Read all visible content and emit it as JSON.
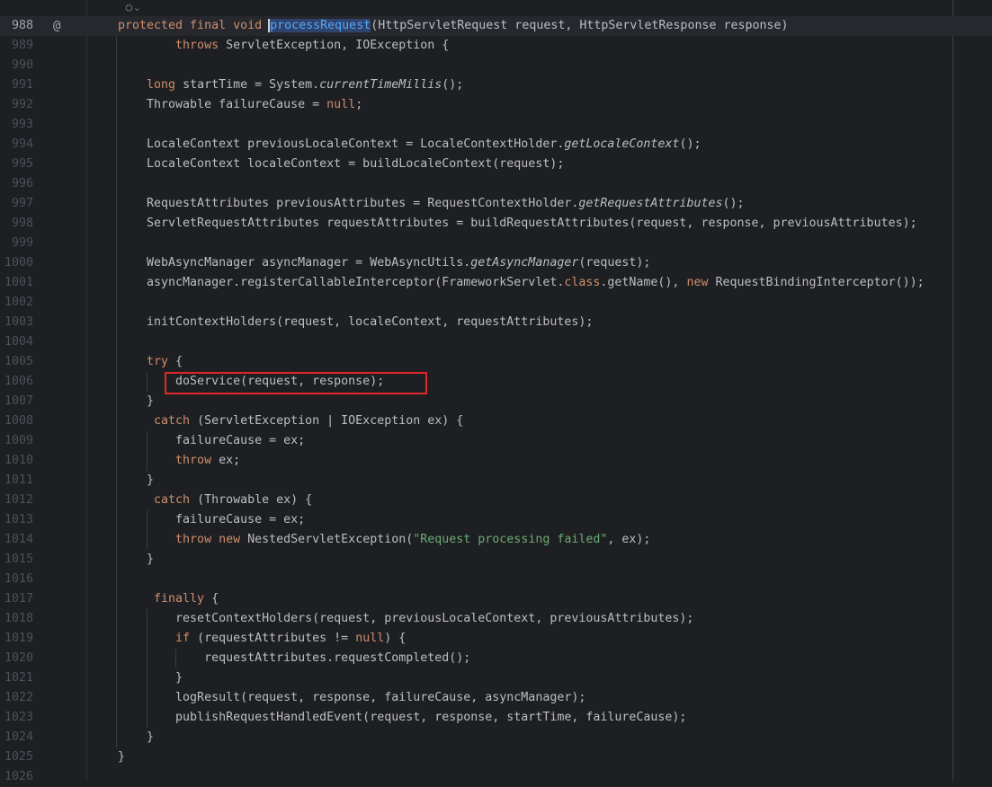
{
  "editor": {
    "inlay_icon": "hierarchy-icon",
    "current_line": 988,
    "highlighted_line": 1006,
    "colors": {
      "background": "#1e1f22",
      "keyword": "#cf8e6d",
      "method": "#56a8f5",
      "text": "#bcbec4",
      "string": "#6aab73",
      "highlight_box": "#e0262b"
    },
    "lines": [
      {
        "n": "988",
        "gutter": "@",
        "t": [
          [
            "protected final void ",
            "kw"
          ],
          [
            "processRequest",
            "fn caret hl"
          ],
          [
            "(HttpServletRequest request, HttpServletResponse response)",
            ""
          ]
        ]
      },
      {
        "n": "989",
        "t": [
          [
            "        throws ",
            "kw"
          ],
          [
            "ServletException, IOException {",
            ""
          ]
        ]
      },
      {
        "n": "990",
        "t": []
      },
      {
        "n": "991",
        "t": [
          [
            "    long ",
            "kw"
          ],
          [
            "startTime = System.",
            ""
          ],
          [
            "currentTimeMillis",
            "st"
          ],
          [
            "();",
            ""
          ]
        ]
      },
      {
        "n": "992",
        "t": [
          [
            "    Throwable failureCause = ",
            ""
          ],
          [
            "null",
            "kw"
          ],
          [
            ";",
            ""
          ]
        ]
      },
      {
        "n": "993",
        "t": []
      },
      {
        "n": "994",
        "t": [
          [
            "    LocaleContext previousLocaleContext = LocaleContextHolder.",
            ""
          ],
          [
            "getLocaleContext",
            "st"
          ],
          [
            "();",
            ""
          ]
        ]
      },
      {
        "n": "995",
        "t": [
          [
            "    LocaleContext localeContext = buildLocaleContext(request);",
            ""
          ]
        ]
      },
      {
        "n": "996",
        "t": []
      },
      {
        "n": "997",
        "t": [
          [
            "    RequestAttributes previousAttributes = RequestContextHolder.",
            ""
          ],
          [
            "getRequestAttributes",
            "st"
          ],
          [
            "();",
            ""
          ]
        ]
      },
      {
        "n": "998",
        "t": [
          [
            "    ServletRequestAttributes requestAttributes = buildRequestAttributes(request, response, previousAttributes);",
            ""
          ]
        ]
      },
      {
        "n": "999",
        "t": []
      },
      {
        "n": "1000",
        "t": [
          [
            "    WebAsyncManager asyncManager = WebAsyncUtils.",
            ""
          ],
          [
            "getAsyncManager",
            "st"
          ],
          [
            "(request);",
            ""
          ]
        ]
      },
      {
        "n": "1001",
        "t": [
          [
            "    asyncManager.registerCallableInterceptor(FrameworkServlet.",
            ""
          ],
          [
            "class",
            "kw"
          ],
          [
            ".getName(), ",
            ""
          ],
          [
            "new ",
            "kw"
          ],
          [
            "RequestBindingInterceptor());",
            ""
          ]
        ]
      },
      {
        "n": "1002",
        "t": []
      },
      {
        "n": "1003",
        "t": [
          [
            "    initContextHolders(request, localeContext, requestAttributes);",
            ""
          ]
        ]
      },
      {
        "n": "1004",
        "t": []
      },
      {
        "n": "1005",
        "t": [
          [
            "    try ",
            "kw"
          ],
          [
            "{",
            ""
          ]
        ]
      },
      {
        "n": "1006",
        "t": [
          [
            "        doService(request, response);",
            ""
          ]
        ]
      },
      {
        "n": "1007",
        "t": [
          [
            "    }",
            ""
          ]
        ]
      },
      {
        "n": "1008",
        "t": [
          [
            "     catch ",
            "kw"
          ],
          [
            "(ServletException | IOException ex) {",
            ""
          ]
        ]
      },
      {
        "n": "1009",
        "t": [
          [
            "        failureCause = ex;",
            ""
          ]
        ]
      },
      {
        "n": "1010",
        "t": [
          [
            "        throw ",
            "kw"
          ],
          [
            "ex;",
            ""
          ]
        ]
      },
      {
        "n": "1011",
        "t": [
          [
            "    }",
            ""
          ]
        ]
      },
      {
        "n": "1012",
        "t": [
          [
            "     catch ",
            "kw"
          ],
          [
            "(Throwable ex) {",
            ""
          ]
        ]
      },
      {
        "n": "1013",
        "t": [
          [
            "        failureCause = ex;",
            ""
          ]
        ]
      },
      {
        "n": "1014",
        "t": [
          [
            "        throw new ",
            "kw"
          ],
          [
            "NestedServletException(",
            ""
          ],
          [
            "\"Request processing failed\"",
            "str"
          ],
          [
            ", ex);",
            ""
          ]
        ]
      },
      {
        "n": "1015",
        "t": [
          [
            "    }",
            ""
          ]
        ]
      },
      {
        "n": "1016",
        "t": []
      },
      {
        "n": "1017",
        "t": [
          [
            "     finally ",
            "kw"
          ],
          [
            "{",
            ""
          ]
        ]
      },
      {
        "n": "1018",
        "t": [
          [
            "        resetContextHolders(request, previousLocaleContext, previousAttributes);",
            ""
          ]
        ]
      },
      {
        "n": "1019",
        "t": [
          [
            "        if ",
            "kw"
          ],
          [
            "(requestAttributes != ",
            ""
          ],
          [
            "null",
            "kw"
          ],
          [
            ") {",
            ""
          ]
        ]
      },
      {
        "n": "1020",
        "t": [
          [
            "            requestAttributes.requestCompleted();",
            ""
          ]
        ]
      },
      {
        "n": "1021",
        "t": [
          [
            "        }",
            ""
          ]
        ]
      },
      {
        "n": "1022",
        "t": [
          [
            "        logResult(request, response, failureCause, asyncManager);",
            ""
          ]
        ]
      },
      {
        "n": "1023",
        "t": [
          [
            "        publishRequestHandledEvent(request, response, startTime, failureCause);",
            ""
          ]
        ]
      },
      {
        "n": "1024",
        "t": [
          [
            "    }",
            ""
          ]
        ]
      },
      {
        "n": "1025",
        "t": [
          [
            "}",
            ""
          ]
        ]
      },
      {
        "n": "1026",
        "t": []
      }
    ]
  }
}
